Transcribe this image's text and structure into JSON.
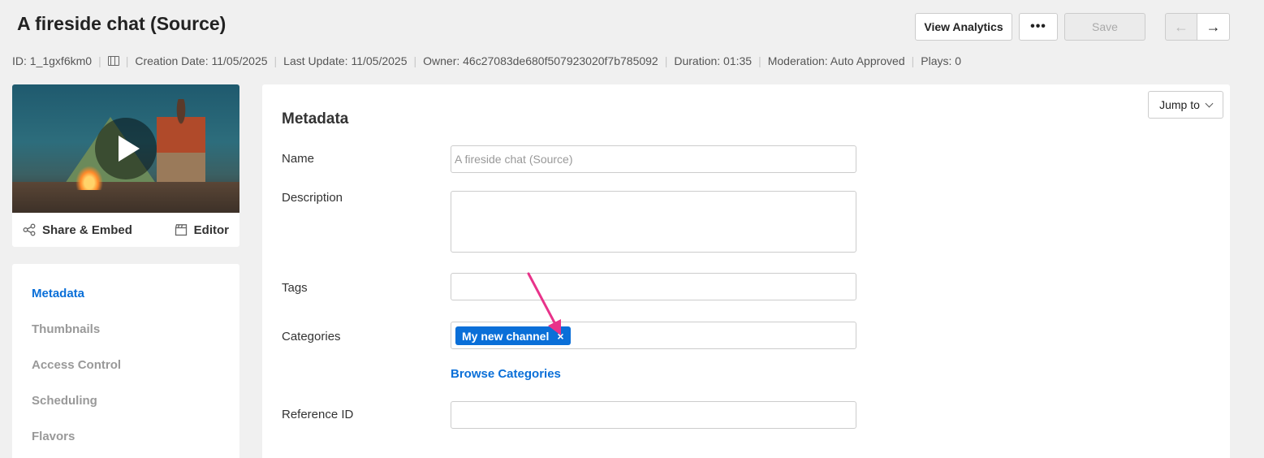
{
  "header": {
    "title": "A fireside chat (Source)",
    "view_analytics_label": "View Analytics",
    "more_label": "•••",
    "save_label": "Save",
    "prev_label": "←",
    "next_label": "→"
  },
  "meta": {
    "id": "ID: 1_1gxf6km0",
    "media_type_icon": "film-icon",
    "creation_date": "Creation Date: 11/05/2025",
    "last_update": "Last Update: 11/05/2025",
    "owner": "Owner: 46c27083de680f507923020f7b785092",
    "duration": "Duration: 01:35",
    "moderation": "Moderation: Auto Approved",
    "plays": "Plays: 0"
  },
  "video_card": {
    "share_label": "Share & Embed",
    "editor_label": "Editor"
  },
  "sidebar": {
    "items": [
      {
        "label": "Metadata",
        "active": true
      },
      {
        "label": "Thumbnails",
        "active": false
      },
      {
        "label": "Access Control",
        "active": false
      },
      {
        "label": "Scheduling",
        "active": false
      },
      {
        "label": "Flavors",
        "active": false
      }
    ]
  },
  "main": {
    "jump_to_label": "Jump to",
    "section_title": "Metadata",
    "fields": {
      "name_label": "Name",
      "name_placeholder": "A fireside chat (Source)",
      "description_label": "Description",
      "tags_label": "Tags",
      "categories_label": "Categories",
      "category_chip": "My new channel",
      "chip_remove": "×",
      "browse_categories": "Browse Categories",
      "reference_id_label": "Reference ID"
    }
  },
  "colors": {
    "accent": "#0a6fd8",
    "annotation_arrow": "#e8338a",
    "background": "#f0f0f0"
  }
}
